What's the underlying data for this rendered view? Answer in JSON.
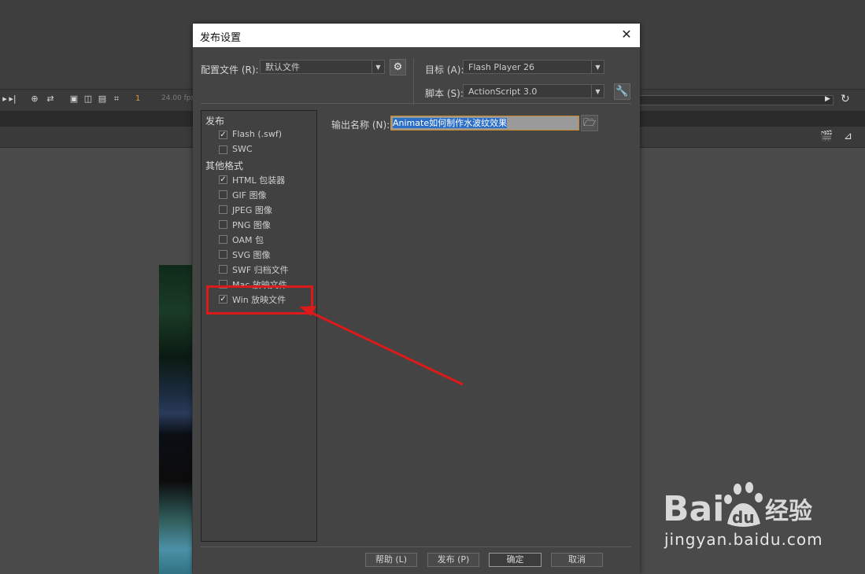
{
  "timeline": {
    "frame": "1",
    "fps": "24.00 fps"
  },
  "dialog": {
    "title": "发布设置",
    "close_glyph": "✕",
    "profile_label": "配置文件 (R):",
    "profile_value": "默认文件",
    "target_label": "目标 (A):",
    "target_value": "Flash Player 26",
    "script_label": "脚本 (S):",
    "script_value": "ActionScript 3.0",
    "publish_header": "发布",
    "other_header": "其他格式",
    "formats": [
      {
        "label": "Flash (.swf)",
        "checked": true
      },
      {
        "label": "SWC",
        "checked": false
      },
      {
        "label": "HTML 包装器",
        "checked": true
      },
      {
        "label": "GIF 图像",
        "checked": false
      },
      {
        "label": "JPEG 图像",
        "checked": false
      },
      {
        "label": "PNG 图像",
        "checked": false
      },
      {
        "label": "OAM 包",
        "checked": false
      },
      {
        "label": "SVG 图像",
        "checked": false
      },
      {
        "label": "SWF 归档文件",
        "checked": false
      },
      {
        "label": "Mac 放映文件",
        "checked": false
      },
      {
        "label": "Win 放映文件",
        "checked": true
      }
    ],
    "output_label": "输出名称 (N):",
    "output_value": "Animate如何制作水波纹效果",
    "buttons": {
      "help": "帮助 (L)",
      "publish": "发布 (P)",
      "ok": "确定",
      "cancel": "取消"
    }
  },
  "watermark": {
    "brand": "Bai du 经验",
    "url": "jingyan.baidu.com"
  },
  "colors": {
    "highlight": "#dd1a1a",
    "selection": "#2a6ec6",
    "dialog_bg": "#444444"
  }
}
